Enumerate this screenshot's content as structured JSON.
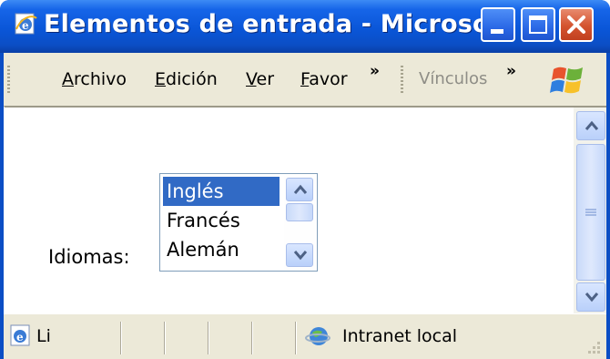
{
  "window": {
    "title": "Elementos de entrada - Microsoft ...",
    "controls": {
      "minimize": "minimize",
      "maximize": "maximize",
      "close": "close"
    }
  },
  "menubar": {
    "items": [
      {
        "label": "Archivo",
        "accel": "A",
        "rest": "rchivo"
      },
      {
        "label": "Edición",
        "accel": "E",
        "rest": "dición"
      },
      {
        "label": "Ver",
        "accel": "V",
        "rest": "er"
      },
      {
        "label": "Favor",
        "accel": "F",
        "rest": "avor"
      }
    ],
    "overflow": "»",
    "links_label": "Vínculos",
    "links_overflow": "»"
  },
  "content": {
    "label": "Idiomas:",
    "listbox": {
      "options": [
        "Inglés",
        "Francés",
        "Alemán"
      ],
      "selected": "Inglés"
    }
  },
  "statusbar": {
    "text": "Li",
    "zone": "Intranet local"
  },
  "icons": {
    "app": "ie-page-icon",
    "windows_logo": "windows-flag-icon",
    "zone": "globe-icon"
  }
}
